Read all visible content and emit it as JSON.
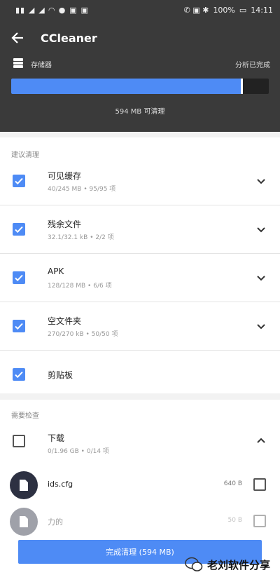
{
  "status_bar": {
    "time": "14:11",
    "battery": "100%"
  },
  "header": {
    "title": "CCleaner"
  },
  "storage": {
    "label": "存储器",
    "right_label": "分析已完成",
    "used_fraction": 0.9,
    "freeable_text": "594 MB 可清理"
  },
  "section_suggested": {
    "title": "建议清理"
  },
  "items": [
    {
      "name": "可见缓存",
      "detail": "40/245 MB • 95/95 项",
      "checked": true,
      "expandable": true
    },
    {
      "name": "残余文件",
      "detail": "32.1/32.1 kB • 2/2 项",
      "checked": true,
      "expandable": true
    },
    {
      "name": "APK",
      "detail": "128/128 MB • 6/6 项",
      "checked": true,
      "expandable": true
    },
    {
      "name": "空文件夹",
      "detail": "270/270 kB • 50/50 项",
      "checked": true,
      "expandable": true
    },
    {
      "name": "剪贴板",
      "detail": "",
      "checked": true,
      "expandable": false
    }
  ],
  "section_review": {
    "title": "需要检查"
  },
  "downloads": {
    "name": "下载",
    "detail": "0/1.96 GB • 0/14 项",
    "checked": false
  },
  "files": [
    {
      "name": "ids.cfg",
      "size": "640 B"
    },
    {
      "name": "力的",
      "size": "50 B"
    }
  ],
  "clean_button": {
    "label": "完成清理 (594 MB)"
  },
  "watermark": {
    "text": "老刘软件分享"
  }
}
